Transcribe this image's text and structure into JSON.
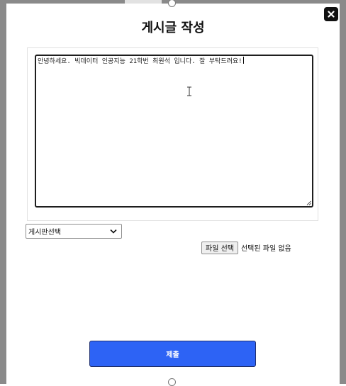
{
  "modal": {
    "title": "게시글 작성",
    "close_icon": "close-icon"
  },
  "editor": {
    "content": "안녕하세요. 빅데이터 인공지능 21학번 최원석 입니다. 잘 부탁드려요!"
  },
  "board_select": {
    "selected": "게시판선택",
    "icon": "chevron-down-icon"
  },
  "file_input": {
    "button_label": "파일 선택",
    "status": "선택된 파일 없음"
  },
  "submit": {
    "label": "제출"
  },
  "colors": {
    "backdrop": "#8a8a8a",
    "submit_background": "#2d63f5",
    "close_background": "#111111"
  }
}
